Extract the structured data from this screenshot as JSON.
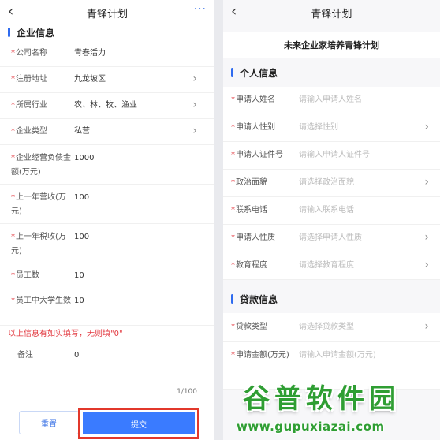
{
  "left": {
    "nav": {
      "back_icon": "‹",
      "title": "青锋计划",
      "more_icon": "···"
    },
    "section_title": "企业信息",
    "rows": [
      {
        "label": "公司名称",
        "value": "青春活力",
        "arrow": false
      },
      {
        "label": "注册地址",
        "value": "九龙坡区",
        "arrow": true
      },
      {
        "label": "所属行业",
        "value": "农、林、牧、渔业",
        "arrow": true
      },
      {
        "label": "企业类型",
        "value": "私营",
        "arrow": true
      },
      {
        "label": "企业经营负债金额(万元)",
        "value": "1000",
        "arrow": false
      },
      {
        "label": "上一年营收(万元)",
        "value": "100",
        "arrow": false
      },
      {
        "label": "上一年税收(万元)",
        "value": "100",
        "arrow": false
      },
      {
        "label": "员工数",
        "value": "10",
        "arrow": false
      },
      {
        "label": "员工中大学生数",
        "value": "10",
        "arrow": false
      }
    ],
    "note": "以上信息有如实填写，无则填\"0\"",
    "remark": {
      "label": "备注",
      "value": "0"
    },
    "counter": "1/100",
    "reset_label": "重置",
    "submit_label": "提交"
  },
  "right": {
    "nav": {
      "back_icon": "‹",
      "title": "青锋计划"
    },
    "card_title": "未来企业家培养青锋计划",
    "personal": {
      "title": "个人信息",
      "rows": [
        {
          "label": "申请人姓名",
          "placeholder": "请输入申请人姓名",
          "arrow": false
        },
        {
          "label": "申请人性别",
          "placeholder": "请选择性别",
          "arrow": true
        },
        {
          "label": "申请人证件号",
          "placeholder": "请输入申请人证件号",
          "arrow": false
        },
        {
          "label": "政治面貌",
          "placeholder": "请选择政治面貌",
          "arrow": true
        },
        {
          "label": "联系电话",
          "placeholder": "请输入联系电话",
          "arrow": false
        },
        {
          "label": "申请人性质",
          "placeholder": "请选择申请人性质",
          "arrow": true
        },
        {
          "label": "教育程度",
          "placeholder": "请选择教育程度",
          "arrow": true
        }
      ]
    },
    "loan": {
      "title": "贷款信息",
      "rows": [
        {
          "label": "贷款类型",
          "placeholder": "请选择贷款类型",
          "arrow": true
        },
        {
          "label": "申请金额(万元)",
          "placeholder": "请输入申请金额(万元)",
          "arrow": false
        }
      ]
    }
  },
  "watermark": {
    "brand": "谷普软件园",
    "url": "www.gupuxiazai.com"
  },
  "colors": {
    "accent": "#3a7bff",
    "required": "#e2383f",
    "highlight": "#e2382b",
    "watermark": "#2f9e33"
  }
}
